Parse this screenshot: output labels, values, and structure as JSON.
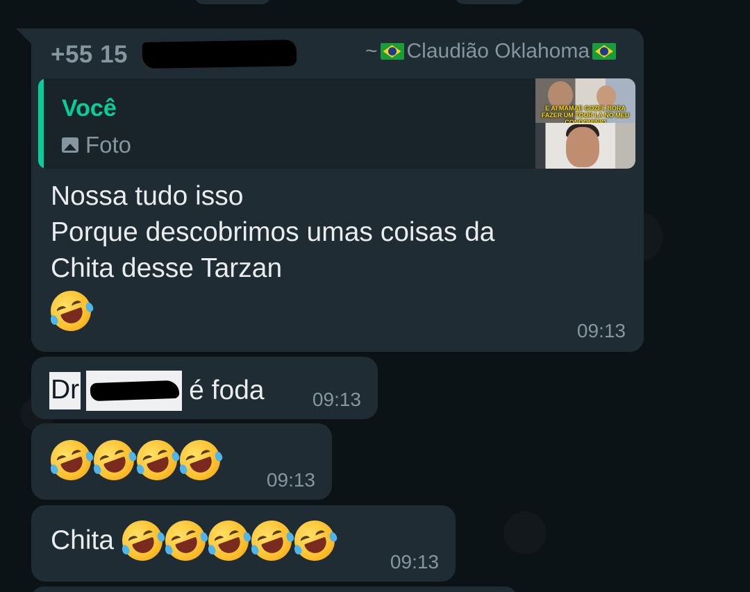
{
  "message1": {
    "sender_phone": "+55 15",
    "sender_name": "~🇧🇷Claudião Oklahoma🇧🇷",
    "sender_name_text": "Claudião Oklahoma",
    "sender_prefix": "~",
    "quote": {
      "author": "Você",
      "type": "Foto",
      "thumbnail_caption": "E AI MAMAE GOZEI, BORA FAZER UM TOUR LA NO MEU CONDOMINIO"
    },
    "lines": [
      "Nossa tudo isso",
      "Porque descobrimos umas coisas da",
      "Chita desse Tarzan"
    ],
    "emoji_icon": "rolling-on-floor-laughing-emoji",
    "time": "09:13"
  },
  "message2": {
    "prefix": "Dr",
    "suffix": "é foda",
    "time": "09:13"
  },
  "message3": {
    "emoji_count": 4,
    "emoji_icon": "rolling-on-floor-laughing-emoji",
    "time": "09:13"
  },
  "message4": {
    "label": "Chita",
    "emoji_count": 5,
    "emoji_icon": "rolling-on-floor-laughing-emoji",
    "time": "09:13"
  },
  "colors": {
    "background": "#0c1317",
    "bubble": "#1f2c34",
    "quote_accent": "#06cf9c",
    "text": "#e9edef",
    "meta": "#8696a0"
  }
}
